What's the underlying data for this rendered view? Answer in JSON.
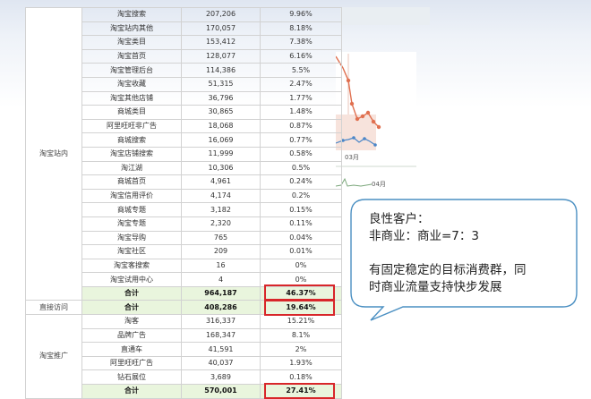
{
  "table": {
    "groups": [
      {
        "name": "淘宝站内",
        "rows": [
          {
            "source": "淘宝搜索",
            "visits": "207,206",
            "share": "9.96%"
          },
          {
            "source": "淘宝站内其他",
            "visits": "170,057",
            "share": "8.18%"
          },
          {
            "source": "淘宝类目",
            "visits": "153,412",
            "share": "7.38%"
          },
          {
            "source": "淘宝首页",
            "visits": "128,077",
            "share": "6.16%"
          },
          {
            "source": "淘宝管理后台",
            "visits": "114,386",
            "share": "5.5%"
          },
          {
            "source": "淘宝收藏",
            "visits": "51,315",
            "share": "2.47%"
          },
          {
            "source": "淘宝其他店铺",
            "visits": "36,796",
            "share": "1.77%"
          },
          {
            "source": "商城类目",
            "visits": "30,865",
            "share": "1.48%"
          },
          {
            "source": "阿里旺旺非广告",
            "visits": "18,068",
            "share": "0.87%"
          },
          {
            "source": "商城搜索",
            "visits": "16,069",
            "share": "0.77%"
          },
          {
            "source": "淘宝店铺搜索",
            "visits": "11,999",
            "share": "0.58%"
          },
          {
            "source": "淘江湖",
            "visits": "10,306",
            "share": "0.5%"
          },
          {
            "source": "商城首页",
            "visits": "4,961",
            "share": "0.24%"
          },
          {
            "source": "淘宝信用评价",
            "visits": "4,174",
            "share": "0.2%"
          },
          {
            "source": "商城专题",
            "visits": "3,182",
            "share": "0.15%"
          },
          {
            "source": "淘宝专题",
            "visits": "2,320",
            "share": "0.11%"
          },
          {
            "source": "淘宝导购",
            "visits": "765",
            "share": "0.04%"
          },
          {
            "source": "淘宝社区",
            "visits": "209",
            "share": "0.01%"
          },
          {
            "source": "淘宝客搜索",
            "visits": "16",
            "share": "0%"
          },
          {
            "source": "淘宝试用中心",
            "visits": "4",
            "share": "0%"
          }
        ],
        "total": {
          "label": "合计",
          "visits": "964,187",
          "share": "46.37%"
        }
      },
      {
        "name": "直接访问",
        "rows": [],
        "total": {
          "label": "合计",
          "visits": "408,286",
          "share": "19.64%"
        }
      },
      {
        "name": "淘宝推广",
        "rows": [
          {
            "source": "淘客",
            "visits": "316,337",
            "share": "15.21%"
          },
          {
            "source": "品牌广告",
            "visits": "168,347",
            "share": "8.1%"
          },
          {
            "source": "直通车",
            "visits": "41,591",
            "share": "2%"
          },
          {
            "source": "阿里旺旺广告",
            "visits": "40,037",
            "share": "1.93%"
          },
          {
            "source": "钻石展位",
            "visits": "3,689",
            "share": "0.18%"
          }
        ],
        "total": {
          "label": "合计",
          "visits": "570,001",
          "share": "27.41%"
        }
      }
    ]
  },
  "background_chart": {
    "month_labels": [
      "03月",
      "04月"
    ]
  },
  "callout": {
    "line1": "良性客户：",
    "line2": "非商业：商业=7：3",
    "line3": "有固定稳定的目标消费群，同",
    "line4": "时商业流量支持快步发展"
  },
  "colors": {
    "highlight_border": "#d8262a",
    "total_row_bg": "#e9f5dd",
    "callout_border": "#4a8fc2"
  }
}
